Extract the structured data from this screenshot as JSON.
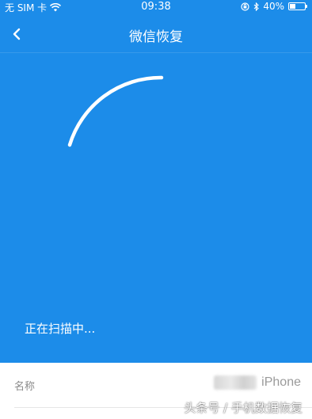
{
  "status_bar": {
    "carrier": "无 SIM 卡",
    "time": "09:38",
    "battery_percent_text": "40%",
    "battery_level": 0.4,
    "icons": [
      "wifi-icon",
      "rotation-lock-icon",
      "bluetooth-icon",
      "battery-icon"
    ]
  },
  "nav": {
    "title": "微信恢复",
    "back_icon": "chevron-left-icon"
  },
  "scan": {
    "status_text": "正在扫描中..."
  },
  "info": {
    "label": "名称",
    "value": "iPhone"
  },
  "watermark": "头条号 / 手机数据恢复",
  "colors": {
    "primary_blue": "#1c8ce9",
    "white": "#ffffff",
    "label_gray": "#8a8a8a"
  }
}
